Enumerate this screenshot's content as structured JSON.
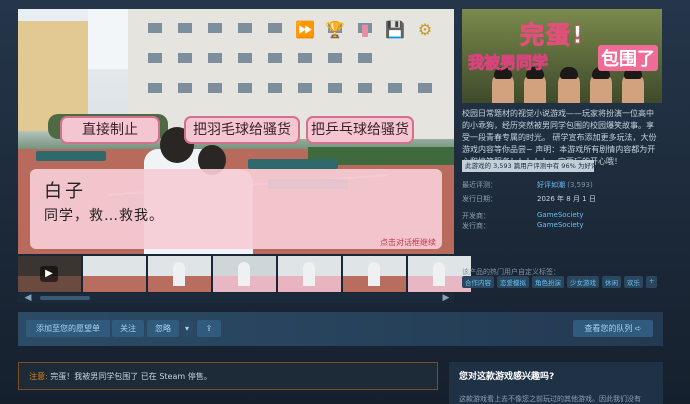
{
  "screenshot": {
    "choices": [
      "直接制止",
      "把羽毛球给骚货",
      "把乒乓球给骚货"
    ],
    "speaker": "白子",
    "line": "同学，救…救我。",
    "skip_hint": "点击对话框继续"
  },
  "capsule": {
    "title_line1": "完蛋!",
    "title_line2": "我被男同学",
    "title_line3": "包围了"
  },
  "description": "校园日常题材的视觉小说游戏——玩家将扮演一位高中的小乖狗，经历突然被男同学包围的校园爆笑故事。享受一段青春专属的时光。 研学宣布添加更多玩法，大份游戏内容等你品尝~ 声明：本游戏所有剧情内容都为开心和搞笑服务！！！！！一定要玩的开心哦！",
  "tooltip": "此游戏的 3,593 篇用户评测中有 96% 为好评。",
  "meta": {
    "reviews_label": "最近评测：",
    "reviews_value": "好评如潮",
    "reviews_count": "(3,593)",
    "release_label": "发行日期：",
    "release_value": "2026 年 8 月 1 日",
    "developer_label": "开发商：",
    "developer_value": "GameSociety",
    "publisher_label": "发行商：",
    "publisher_value": "GameSociety"
  },
  "tags_label": "该产品的热门用户自定义标签：",
  "tags": [
    "合作内容",
    "恋爱模拟",
    "角色扮演",
    "少女游戏",
    "休闲",
    "欢乐",
    "+"
  ],
  "actions": {
    "wishlist": "添加至您的愿望单",
    "follow": "关注",
    "ignore": "忽略",
    "dropdown": "▾",
    "share": "⇪",
    "queue": "查看您的队列 ➪"
  },
  "notice": {
    "prefix": "注意:",
    "text": " 完蛋！我被男同学包围了 已在 Steam 停售。"
  },
  "interest": {
    "heading": "您对这款游戏感兴趣吗?",
    "body": "这款游戏看上去不像您之前玩过的其他游戏。因此我们没有"
  },
  "colors": {
    "link": "#66c0f4",
    "accent_pink": "#e88ca6",
    "warning": "#e0891b"
  },
  "icons": [
    "fast-forward-icon",
    "trophy-icon",
    "bookmark-icon",
    "save-icon",
    "settings-icon"
  ]
}
